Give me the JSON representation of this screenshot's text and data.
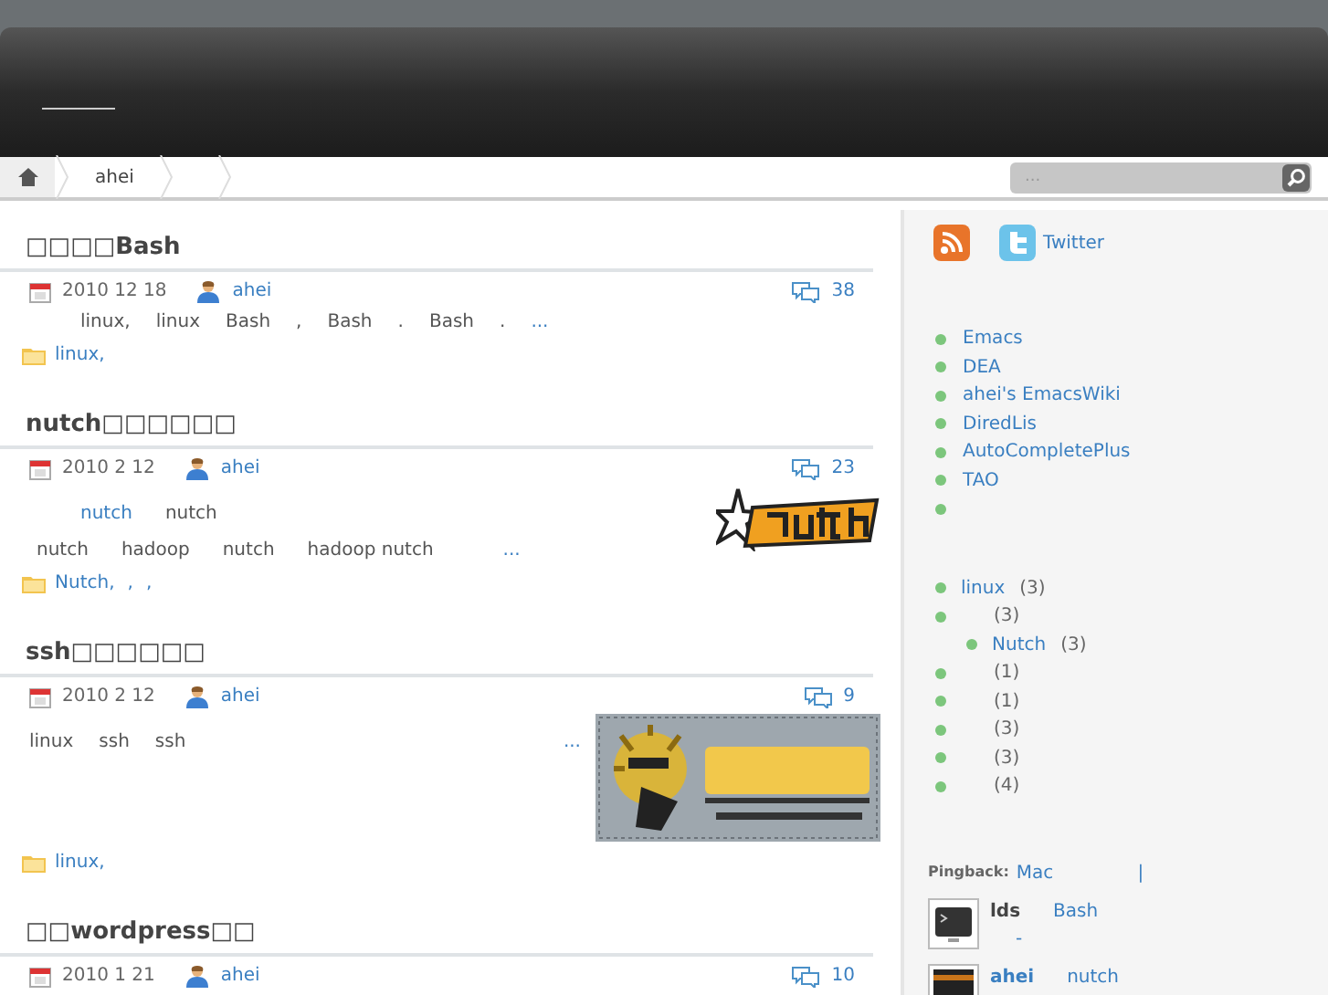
{
  "breadcrumbs": [
    {
      "kind": "text",
      "label": "ahei"
    },
    {
      "kind": "blank"
    },
    {
      "kind": "blank"
    }
  ],
  "search": {
    "placeholder": "..."
  },
  "posts": [
    {
      "title": "□□□□Bash",
      "date": "2010 12 18",
      "author": "ahei",
      "comments": "38",
      "excerpt": [
        "linux,",
        "linux",
        "Bash",
        ",",
        "Bash",
        ".",
        "Bash",
        "."
      ],
      "more": "...",
      "tags": [
        "linux,"
      ]
    },
    {
      "title": "nutch□□□□□□",
      "date": "2010 2 12",
      "author": "ahei",
      "comments": "23",
      "lines": [
        [
          {
            "t": "nutch",
            "link": true
          },
          {
            "t": "nutch",
            "link": false
          }
        ],
        [
          {
            "t": "nutch",
            "link": false
          },
          {
            "t": "hadoop",
            "link": false
          },
          {
            "t": "nutch",
            "link": false
          },
          {
            "t": "hadoop nutch",
            "link": false
          }
        ]
      ],
      "more": "...",
      "tags": [
        "Nutch,",
        ",",
        ","
      ],
      "kind": "logo"
    },
    {
      "title": "ssh□□□□□□",
      "date": "2010 2 12",
      "author": "ahei",
      "comments": "9",
      "excerpt": [
        "linux",
        "ssh",
        "ssh"
      ],
      "more": "...",
      "tags": [
        "linux,"
      ],
      "kind": "picture"
    },
    {
      "title": "□□wordpress□□",
      "date": "2010 1 21",
      "author": "ahei",
      "comments": "10"
    }
  ],
  "social": {
    "twitter": "Twitter"
  },
  "links": [
    {
      "kind": "link",
      "label": "Emacs"
    },
    {
      "kind": "link",
      "label": "DEA"
    },
    {
      "kind": "link",
      "label": "ahei's EmacsWiki"
    },
    {
      "kind": "link",
      "label": "DiredLis"
    },
    {
      "kind": "link",
      "label": "AutoCompletePlus"
    },
    {
      "kind": "link",
      "label": "TAO"
    },
    {
      "kind": "blank"
    }
  ],
  "categories": [
    {
      "label": "linux",
      "count": "(3)"
    },
    {
      "count": "(3)",
      "children": [
        {
          "label": "Nutch",
          "count": "(3)"
        }
      ]
    },
    {
      "count": "(1)"
    },
    {
      "count": "(1)"
    },
    {
      "count": "(3)"
    },
    {
      "count": "(3)"
    },
    {
      "count": "(4)"
    }
  ],
  "recent": {
    "pingback": {
      "prefix": "Pingback:",
      "link": "Mac",
      "sep": "|"
    },
    "comments": [
      {
        "author": "lds",
        "link": "Bash",
        "note": "-",
        "kind": "terminal"
      },
      {
        "author": "ahei",
        "link": "nutch"
      }
    ]
  }
}
